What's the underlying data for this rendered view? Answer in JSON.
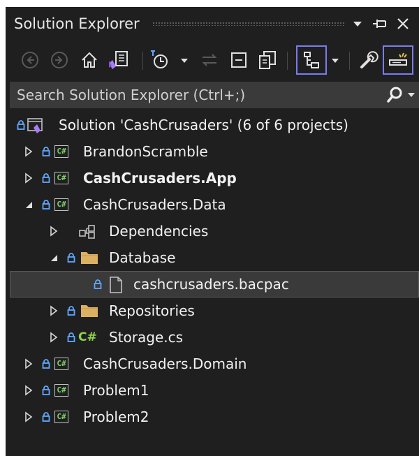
{
  "panel": {
    "title": "Solution Explorer",
    "title_buttons": [
      "window-position-dropdown",
      "auto-hide-pin",
      "close"
    ]
  },
  "toolbar": {
    "buttons": [
      "back",
      "forward",
      "home",
      "switch-views",
      "pending-changes-filter",
      "sync",
      "collapse-all",
      "show-all-files",
      "track-active-item",
      "properties",
      "preview-selected-items"
    ]
  },
  "search": {
    "placeholder": "Search Solution Explorer (Ctrl+;)"
  },
  "tree": {
    "solution": "Solution 'CashCrusaders' (6 of 6 projects)",
    "items": [
      {
        "label": "BrandonScramble",
        "expanded": false,
        "type": "csproj",
        "bold": false
      },
      {
        "label": "CashCrusaders.App",
        "expanded": false,
        "type": "csproj",
        "bold": true
      },
      {
        "label": "CashCrusaders.Data",
        "expanded": true,
        "type": "csproj",
        "bold": false
      },
      {
        "label": "Dependencies",
        "expanded": false,
        "type": "dependencies",
        "bold": false
      },
      {
        "label": "Database",
        "expanded": true,
        "type": "folder",
        "bold": false
      },
      {
        "label": "cashcrusaders.bacpac",
        "type": "file",
        "selected": true,
        "bold": false
      },
      {
        "label": "Repositories",
        "expanded": false,
        "type": "folder",
        "bold": false
      },
      {
        "label": "Storage.cs",
        "expanded": false,
        "type": "csfile",
        "bold": false
      },
      {
        "label": "CashCrusaders.Domain",
        "expanded": false,
        "type": "csproj",
        "bold": false
      },
      {
        "label": "Problem1",
        "expanded": false,
        "type": "csproj",
        "bold": false
      },
      {
        "label": "Problem2",
        "expanded": false,
        "type": "csproj",
        "bold": false
      }
    ],
    "csharp_badge": "C#"
  }
}
